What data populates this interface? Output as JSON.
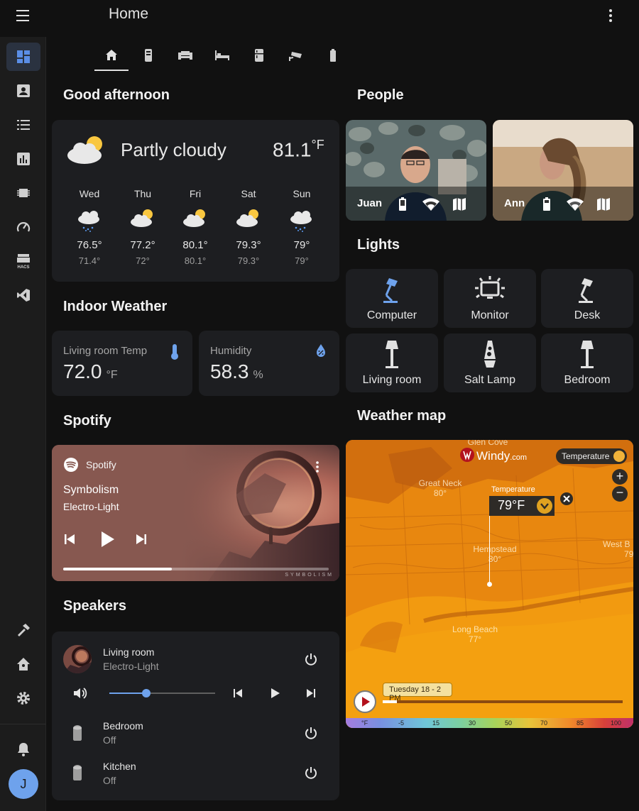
{
  "app": {
    "title": "Home",
    "user_initial": "J"
  },
  "sidebar": {
    "items": [
      {
        "icon": "dashboard-icon",
        "active": true
      },
      {
        "icon": "contact-card-icon"
      },
      {
        "icon": "list-icon"
      },
      {
        "icon": "bar-chart-icon"
      },
      {
        "icon": "chip-icon"
      },
      {
        "icon": "gauge-icon"
      },
      {
        "icon": "hacs-store-icon",
        "label": "HACS"
      },
      {
        "icon": "vscode-icon"
      }
    ],
    "bottom_items": [
      {
        "icon": "hammer-icon"
      },
      {
        "icon": "home-assistant-icon"
      },
      {
        "icon": "gear-icon"
      },
      {
        "icon": "bell-icon"
      }
    ]
  },
  "tabs": [
    "home-icon",
    "phone-icon",
    "sofa-icon",
    "bed-icon",
    "fridge-icon",
    "cctv-icon",
    "battery-icon"
  ],
  "greeting": "Good afternoon",
  "weather": {
    "condition": "Partly cloudy",
    "temperature": "81.1",
    "unit": "°F",
    "forecast": [
      {
        "day": "Wed",
        "high": "76.5°",
        "low": "71.4°",
        "icon": "rain-icon"
      },
      {
        "day": "Thu",
        "high": "77.2°",
        "low": "72°",
        "icon": "partly-cloudy-icon"
      },
      {
        "day": "Fri",
        "high": "80.1°",
        "low": "80.1°",
        "icon": "partly-cloudy-icon"
      },
      {
        "day": "Sat",
        "high": "79.3°",
        "low": "79.3°",
        "icon": "partly-cloudy-icon"
      },
      {
        "day": "Sun",
        "high": "79°",
        "low": "79°",
        "icon": "rain-icon"
      }
    ]
  },
  "indoor": {
    "heading": "Indoor Weather",
    "temp": {
      "name": "Living room Temp",
      "value": "72.0",
      "unit": "°F"
    },
    "humidity": {
      "name": "Humidity",
      "value": "58.3",
      "unit": "%"
    }
  },
  "spotify": {
    "heading": "Spotify",
    "source": "Spotify",
    "track": "Symbolism",
    "artist": "Electro-Light",
    "art_caption": "SYMBOLISM",
    "progress": 0.41
  },
  "speakers": {
    "heading": "Speakers",
    "main": {
      "name": "Living room",
      "sub": "Electro-Light",
      "volume": 0.35
    },
    "others": [
      {
        "name": "Bedroom",
        "state": "Off"
      },
      {
        "name": "Kitchen",
        "state": "Off"
      }
    ]
  },
  "people": {
    "heading": "People",
    "list": [
      {
        "name": "Juan"
      },
      {
        "name": "Ann"
      }
    ]
  },
  "lights": {
    "heading": "Lights",
    "list": [
      {
        "name": "Computer",
        "icon": "desk-lamp-icon",
        "on": true
      },
      {
        "name": "Monitor",
        "icon": "monitor-light-icon",
        "on": false
      },
      {
        "name": "Desk",
        "icon": "desk-lamp-icon",
        "on": false
      },
      {
        "name": "Living room",
        "icon": "floor-lamp-icon",
        "on": false
      },
      {
        "name": "Salt Lamp",
        "icon": "lava-lamp-icon",
        "on": false
      },
      {
        "name": "Bedroom",
        "icon": "floor-lamp-icon",
        "on": false
      }
    ]
  },
  "map": {
    "heading": "Weather map",
    "brand": "Windy",
    "brand_suffix": ".com",
    "layer": "Temperature",
    "popup_label": "Temperature",
    "popup_value": "79°F",
    "places": [
      {
        "name": "Glen Cove",
        "temp": ""
      },
      {
        "name": "Great Neck",
        "temp": "80°"
      },
      {
        "name": "Hempstead",
        "temp": "80°"
      },
      {
        "name": "West B",
        "temp": "79"
      },
      {
        "name": "Long Beach",
        "temp": "77°"
      }
    ],
    "time": "Tuesday 18 - 2 PM",
    "scale": [
      "°F",
      "-5",
      "15",
      "30",
      "50",
      "70",
      "85",
      "100"
    ],
    "accent": "#e7860f"
  }
}
